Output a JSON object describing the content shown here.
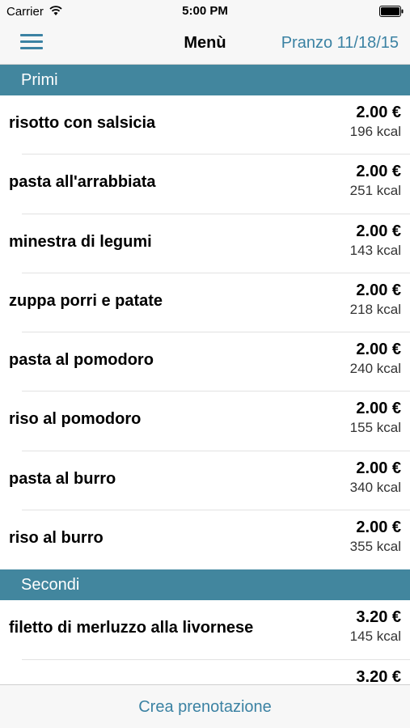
{
  "status": {
    "carrier": "Carrier",
    "time": "5:00 PM"
  },
  "nav": {
    "title": "Menù",
    "right_label": "Pranzo 11/18/15"
  },
  "sections": [
    {
      "title": "Primi",
      "items": [
        {
          "name": "risotto con salsicia",
          "price": "2.00 €",
          "kcal": "196 kcal"
        },
        {
          "name": "pasta all'arrabbiata",
          "price": "2.00 €",
          "kcal": "251 kcal"
        },
        {
          "name": "minestra di legumi",
          "price": "2.00 €",
          "kcal": "143 kcal"
        },
        {
          "name": "zuppa porri e patate",
          "price": "2.00 €",
          "kcal": "218 kcal"
        },
        {
          "name": "pasta al pomodoro",
          "price": "2.00 €",
          "kcal": "240 kcal"
        },
        {
          "name": "riso al pomodoro",
          "price": "2.00 €",
          "kcal": "155 kcal"
        },
        {
          "name": "pasta al burro",
          "price": "2.00 €",
          "kcal": "340 kcal"
        },
        {
          "name": "riso al burro",
          "price": "2.00 €",
          "kcal": "355 kcal"
        }
      ]
    },
    {
      "title": "Secondi",
      "items": [
        {
          "name": "filetto di merluzzo alla livornese",
          "price": "3.20 €",
          "kcal": "145 kcal"
        },
        {
          "name": "",
          "price": "3.20 €",
          "kcal": ""
        }
      ]
    }
  ],
  "bottom": {
    "button_label": "Crea prenotazione"
  },
  "colors": {
    "accent": "#3b82a3",
    "section_header": "#42869e",
    "bar_background": "#f7f7f7"
  },
  "icons": {
    "menu": "hamburger-menu-icon",
    "wifi": "wifi-icon",
    "battery": "battery-icon"
  }
}
